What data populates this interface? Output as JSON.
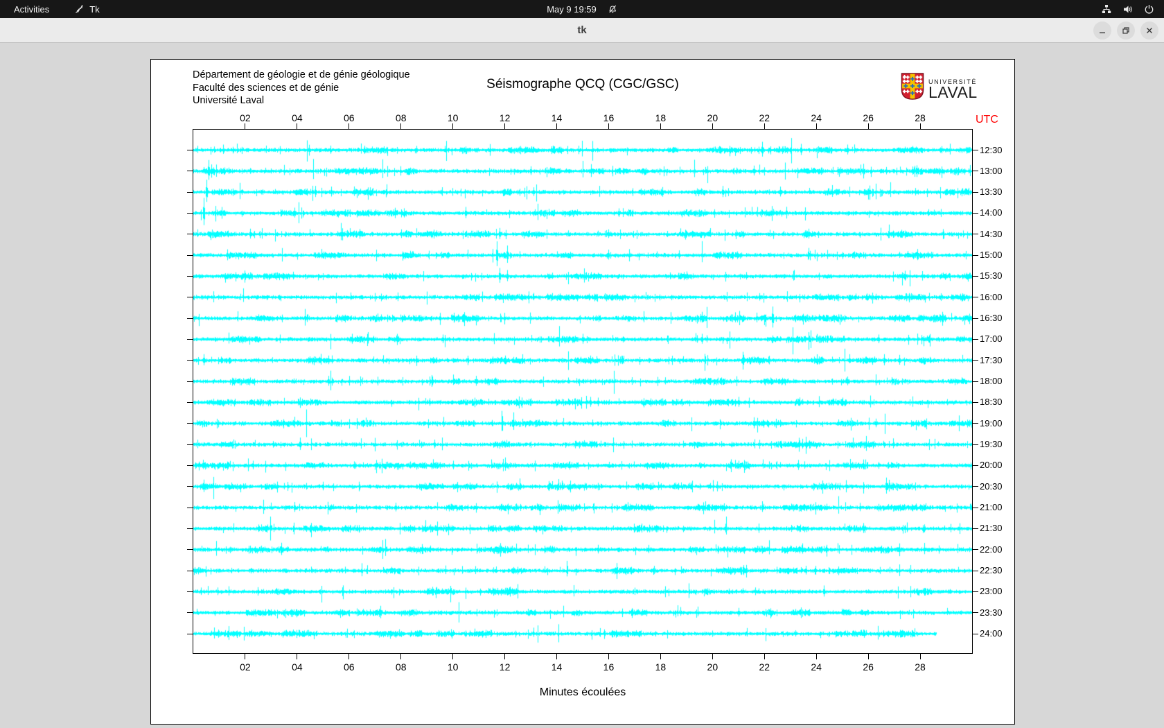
{
  "topbar": {
    "activities_label": "Activities",
    "app_name": "Tk",
    "clock": "May 9 19:59"
  },
  "window": {
    "title": "tk"
  },
  "logo": {
    "top": "UNIVERSITÉ",
    "bottom": "LAVAL"
  },
  "seismograph": {
    "header_lines": [
      "Département de géologie et de génie géologique",
      "Faculté des sciences et de génie",
      "Université Laval"
    ],
    "title": "Séismographe QCQ (CGC/GSC)",
    "xlabel": "Minutes écoulées",
    "utc_heading": "UTC",
    "utc_color": "#ff0000",
    "trace_color": "#00ffff",
    "minutes_span": 30,
    "axis_labels": [
      "02",
      "04",
      "06",
      "08",
      "10",
      "12",
      "14",
      "16",
      "18",
      "20",
      "22",
      "24",
      "26",
      "28"
    ],
    "rows": [
      {
        "utc": "12:30",
        "seed": 101,
        "end_min": 30,
        "spikes": [
          [
            8.6,
            6
          ],
          [
            21.9,
            12
          ],
          [
            23.4,
            9
          ],
          [
            25.2,
            8
          ]
        ]
      },
      {
        "utc": "13:00",
        "seed": 102,
        "end_min": 30,
        "spikes": [
          [
            0.6,
            16
          ],
          [
            13.0,
            7
          ],
          [
            21.6,
            8
          ],
          [
            26.7,
            6
          ]
        ]
      },
      {
        "utc": "13:30",
        "seed": 103,
        "end_min": 30,
        "spikes": [
          [
            0.5,
            18
          ],
          [
            4.7,
            9
          ],
          [
            5.3,
            8
          ],
          [
            6.8,
            7
          ],
          [
            13.1,
            7
          ],
          [
            20.4,
            9
          ],
          [
            22.6,
            8
          ],
          [
            27.8,
            6
          ]
        ]
      },
      {
        "utc": "14:00",
        "seed": 104,
        "end_min": 30,
        "spikes": [
          [
            0.4,
            22
          ],
          [
            3.9,
            8
          ],
          [
            10.5,
            9
          ],
          [
            16.4,
            7
          ]
        ]
      },
      {
        "utc": "14:30",
        "seed": 105,
        "end_min": 30,
        "spikes": [
          [
            2.2,
            8
          ],
          [
            8.0,
            7
          ],
          [
            11.8,
            9
          ],
          [
            16.0,
            7
          ],
          [
            23.7,
            8
          ]
        ]
      },
      {
        "utc": "15:00",
        "seed": 106,
        "end_min": 30,
        "spikes": [
          [
            11.7,
            20
          ],
          [
            12.1,
            14
          ],
          [
            16.0,
            8
          ],
          [
            18.7,
            7
          ],
          [
            27.9,
            9
          ]
        ]
      },
      {
        "utc": "15:30",
        "seed": 107,
        "end_min": 30,
        "spikes": [
          [
            11.8,
            12
          ],
          [
            12.1,
            9
          ],
          [
            19.0,
            7
          ],
          [
            21.3,
            6
          ],
          [
            27.4,
            8
          ]
        ]
      },
      {
        "utc": "16:00",
        "seed": 108,
        "end_min": 30,
        "spikes": [
          [
            11.0,
            5
          ],
          [
            21.8,
            6
          ]
        ]
      },
      {
        "utc": "16:30",
        "seed": 109,
        "end_min": 30,
        "spikes": [
          [
            9.5,
            7
          ],
          [
            22.3,
            17
          ]
        ]
      },
      {
        "utc": "17:00",
        "seed": 110,
        "end_min": 30,
        "spikes": [
          [
            6.1,
            8
          ],
          [
            9.6,
            7
          ],
          [
            15.0,
            8
          ],
          [
            19.6,
            8
          ],
          [
            26.4,
            7
          ]
        ]
      },
      {
        "utc": "17:30",
        "seed": 111,
        "end_min": 30,
        "spikes": [
          [
            0.4,
            9
          ],
          [
            5.2,
            7
          ],
          [
            12.0,
            7
          ],
          [
            15.3,
            7
          ],
          [
            21.2,
            8
          ],
          [
            26.6,
            9
          ],
          [
            27.2,
            8
          ]
        ]
      },
      {
        "utc": "18:00",
        "seed": 112,
        "end_min": 30,
        "spikes": [
          [
            5.2,
            8
          ],
          [
            9.2,
            7
          ],
          [
            10.9,
            8
          ],
          [
            25.2,
            7
          ]
        ]
      },
      {
        "utc": "18:30",
        "seed": 113,
        "end_min": 30,
        "spikes": [
          [
            9.1,
            6
          ],
          [
            15.3,
            8
          ],
          [
            15.6,
            7
          ],
          [
            21.0,
            8
          ],
          [
            25.0,
            7
          ]
        ]
      },
      {
        "utc": "19:00",
        "seed": 114,
        "end_min": 30,
        "spikes": [
          [
            21.6,
            9
          ],
          [
            26.3,
            7
          ]
        ]
      },
      {
        "utc": "19:30",
        "seed": 115,
        "end_min": 30,
        "spikes": [
          [
            4.1,
            10
          ],
          [
            9.3,
            7
          ]
        ]
      },
      {
        "utc": "20:00",
        "seed": 116,
        "end_min": 30,
        "spikes": [
          [
            2.3,
            7
          ],
          [
            6.2,
            6
          ],
          [
            10.0,
            7
          ],
          [
            21.0,
            7
          ],
          [
            23.3,
            8
          ]
        ]
      },
      {
        "utc": "20:30",
        "seed": 117,
        "end_min": 30,
        "spikes": [
          [
            0.4,
            10
          ],
          [
            5.0,
            7
          ],
          [
            13.7,
            8
          ],
          [
            26.7,
            13
          ]
        ]
      },
      {
        "utc": "21:00",
        "seed": 118,
        "end_min": 30,
        "spikes": [
          [
            3.9,
            8
          ],
          [
            7.8,
            7
          ],
          [
            21.9,
            8
          ]
        ]
      },
      {
        "utc": "21:30",
        "seed": 119,
        "end_min": 30,
        "spikes": [
          [
            2.5,
            6
          ],
          [
            20.5,
            7
          ],
          [
            25.8,
            8
          ]
        ]
      },
      {
        "utc": "22:00",
        "seed": 120,
        "end_min": 30,
        "spikes": [
          [
            3.4,
            10
          ],
          [
            8.8,
            8
          ],
          [
            15.6,
            7
          ]
        ]
      },
      {
        "utc": "22:30",
        "seed": 121,
        "end_min": 30,
        "spikes": [
          [
            21.2,
            8
          ],
          [
            23.6,
            7
          ]
        ]
      },
      {
        "utc": "23:00",
        "seed": 122,
        "end_min": 30,
        "spikes": [
          [
            0.3,
            6
          ],
          [
            9.2,
            7
          ],
          [
            24.3,
            9
          ]
        ]
      },
      {
        "utc": "23:30",
        "seed": 123,
        "end_min": 30,
        "spikes": [
          [
            7.2,
            10
          ],
          [
            21.0,
            7
          ]
        ]
      },
      {
        "utc": "24:00",
        "seed": 124,
        "end_min": 28.6,
        "spikes": [
          [
            23.2,
            5
          ]
        ]
      }
    ]
  }
}
